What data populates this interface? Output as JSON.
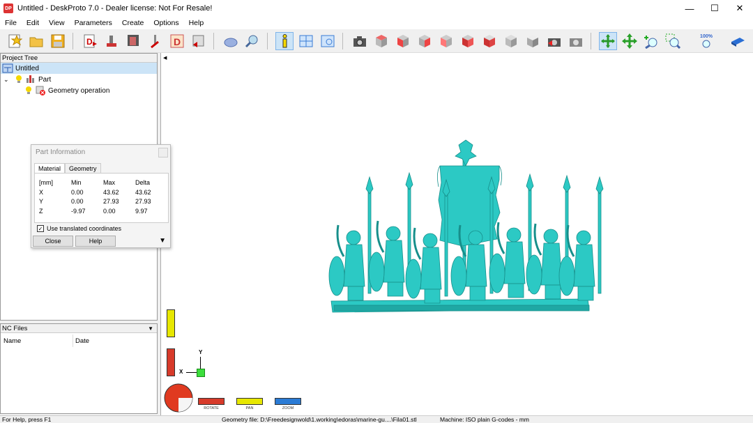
{
  "window": {
    "title": "Untitled - DeskProto 7.0 - Dealer license: Not For Resale!",
    "app_icon_text": "DP",
    "minimize": "—",
    "maximize": "☐",
    "close": "✕"
  },
  "menu": [
    "File",
    "Edit",
    "View",
    "Parameters",
    "Create",
    "Options",
    "Help"
  ],
  "toolbar": {
    "zoom_100_label": "100%"
  },
  "project_tree": {
    "header": "Project Tree",
    "items": {
      "root": "Untitled",
      "part": "Part",
      "geometry": "Geometry operation"
    }
  },
  "nc_files": {
    "header": "NC Files",
    "columns": [
      "Name",
      "Date"
    ]
  },
  "part_info": {
    "title": "Part Information",
    "tabs": [
      "Material",
      "Geometry"
    ],
    "headers": [
      "[mm]",
      "Min",
      "Max",
      "Delta"
    ],
    "rows": [
      [
        "X",
        "0.00",
        "43.62",
        "43.62"
      ],
      [
        "Y",
        "0.00",
        "27.93",
        "27.93"
      ],
      [
        "Z",
        "-9.97",
        "0.00",
        "9.97"
      ]
    ],
    "checkbox_label": "Use translated coordinates",
    "checkbox_checked": true,
    "close_label": "Close",
    "help_label": "Help"
  },
  "viewport": {
    "axis_y": "Y",
    "axis_x": "X",
    "controls": [
      "ROTATE",
      "PAN",
      "ZOOM"
    ],
    "model_color": "#2cc9c4"
  },
  "statusbar": {
    "help": "For Help, press F1",
    "geometry_file": "Geometry file: D:\\Freedesignwold\\1.working\\edoras\\marine-gu....\\Fila01.stl",
    "machine": "Machine: ISO plain G-codes - mm"
  }
}
